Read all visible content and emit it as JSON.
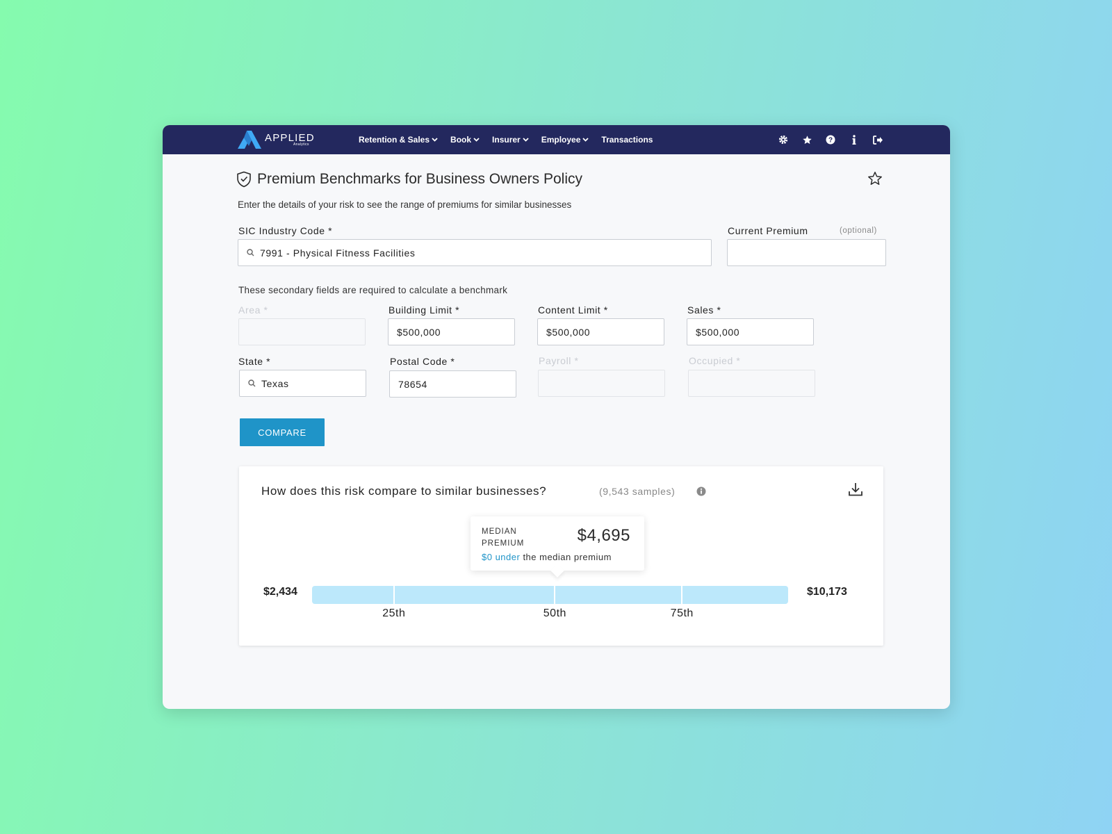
{
  "nav": {
    "brand": "APPLIED",
    "brand_sub": "Analytics",
    "items": [
      {
        "label": "Retention & Sales",
        "dropdown": true
      },
      {
        "label": "Book",
        "dropdown": true
      },
      {
        "label": "Insurer",
        "dropdown": true
      },
      {
        "label": "Employee",
        "dropdown": true
      },
      {
        "label": "Transactions",
        "dropdown": false
      }
    ],
    "icons": [
      "gear-icon",
      "star-icon",
      "help-icon",
      "info-icon",
      "logout-icon"
    ]
  },
  "page": {
    "title": "Premium Benchmarks for Business Owners Policy",
    "subtitle": "Enter the details of your risk to see the range of premiums for similar businesses"
  },
  "form": {
    "sic": {
      "label": "SIC Industry Code",
      "required": "*",
      "value": "7991 - Physical Fitness Facilities"
    },
    "current_premium": {
      "label": "Current Premium",
      "optional": "(optional)",
      "value": ""
    },
    "hint": "These secondary fields are required to calculate a benchmark",
    "area": {
      "label": "Area *",
      "value": ""
    },
    "building_limit": {
      "label": "Building Limit *",
      "value": "$500,000"
    },
    "content_limit": {
      "label": "Content Limit *",
      "value": "$500,000"
    },
    "sales": {
      "label": "Sales *",
      "value": "$500,000"
    },
    "state": {
      "label": "State *",
      "value": "Texas"
    },
    "postal_code": {
      "label": "Postal Code *",
      "value": "78654"
    },
    "payroll": {
      "label": "Payroll *",
      "value": ""
    },
    "occupied": {
      "label": "Occupied *",
      "value": ""
    },
    "compare_label": "COMPARE"
  },
  "result": {
    "question": "How does this risk compare to similar businesses?",
    "samples": "(9,543 samples)",
    "median_label": "MEDIAN PREMIUM",
    "median_value": "$4,695",
    "note_accent": "$0 under",
    "note_rest": " the median premium",
    "min": "$2,434",
    "max": "$10,173",
    "percentiles": [
      {
        "label": "25th",
        "pos": 0.172
      },
      {
        "label": "50th",
        "pos": 0.51
      },
      {
        "label": "75th",
        "pos": 0.777
      }
    ]
  },
  "colors": {
    "nav_bg": "#23285e",
    "accent": "#1f94c8",
    "bar": "#bce8fb",
    "logo_blue": "#3fa9f5"
  }
}
